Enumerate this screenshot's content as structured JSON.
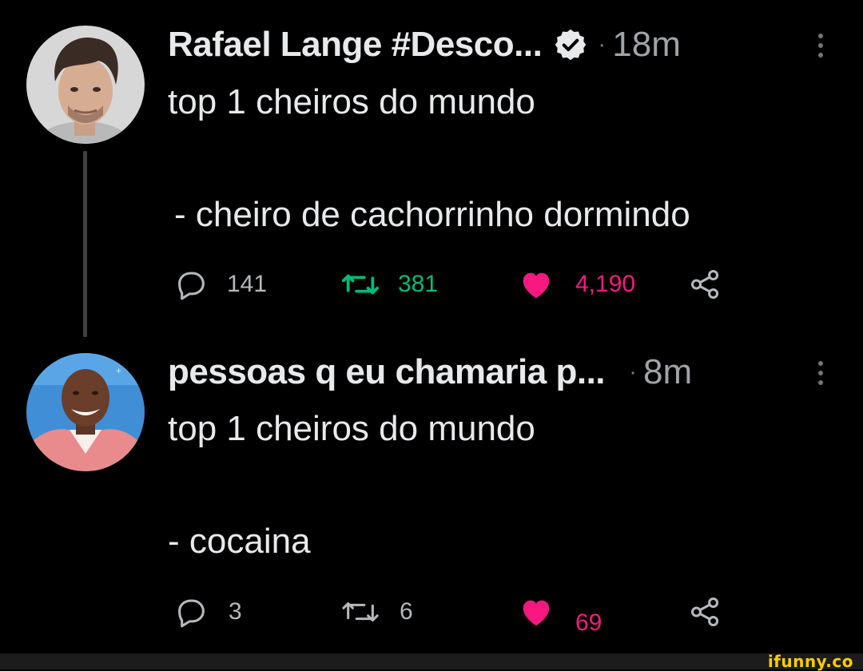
{
  "colors": {
    "background": "#000000",
    "text_primary": "#e7e9ea",
    "text_secondary": "#a0a4a8",
    "retweet_active": "#00ba7c",
    "like": "#f91880",
    "thread_line": "#3e4144",
    "watermark": "#ffcc00"
  },
  "tweets": [
    {
      "display_name": "Rafael Lange #Desco...",
      "verified": true,
      "dot": "·",
      "time": "18m",
      "lines": [
        "top 1 cheiros do mundo",
        "- cheiro de cachorrinho dormindo"
      ],
      "replies": "141",
      "retweets": "381",
      "likes": "4,190",
      "retweeted": true,
      "liked": true,
      "icons": [
        "reply-icon",
        "retweet-icon",
        "heart-icon",
        "share-icon",
        "more-vertical-icon",
        "verified-badge-icon"
      ]
    },
    {
      "display_name": "pessoas q eu chamaria p...",
      "verified": false,
      "dot": "·",
      "time": "8m",
      "lines": [
        "top 1 cheiros do mundo",
        "- cocaina"
      ],
      "replies": "3",
      "retweets": "6",
      "likes": "69",
      "retweeted": false,
      "liked": true,
      "icons": [
        "reply-icon",
        "retweet-icon",
        "heart-icon",
        "share-icon",
        "more-vertical-icon"
      ]
    }
  ],
  "watermark": "ifunny.co"
}
